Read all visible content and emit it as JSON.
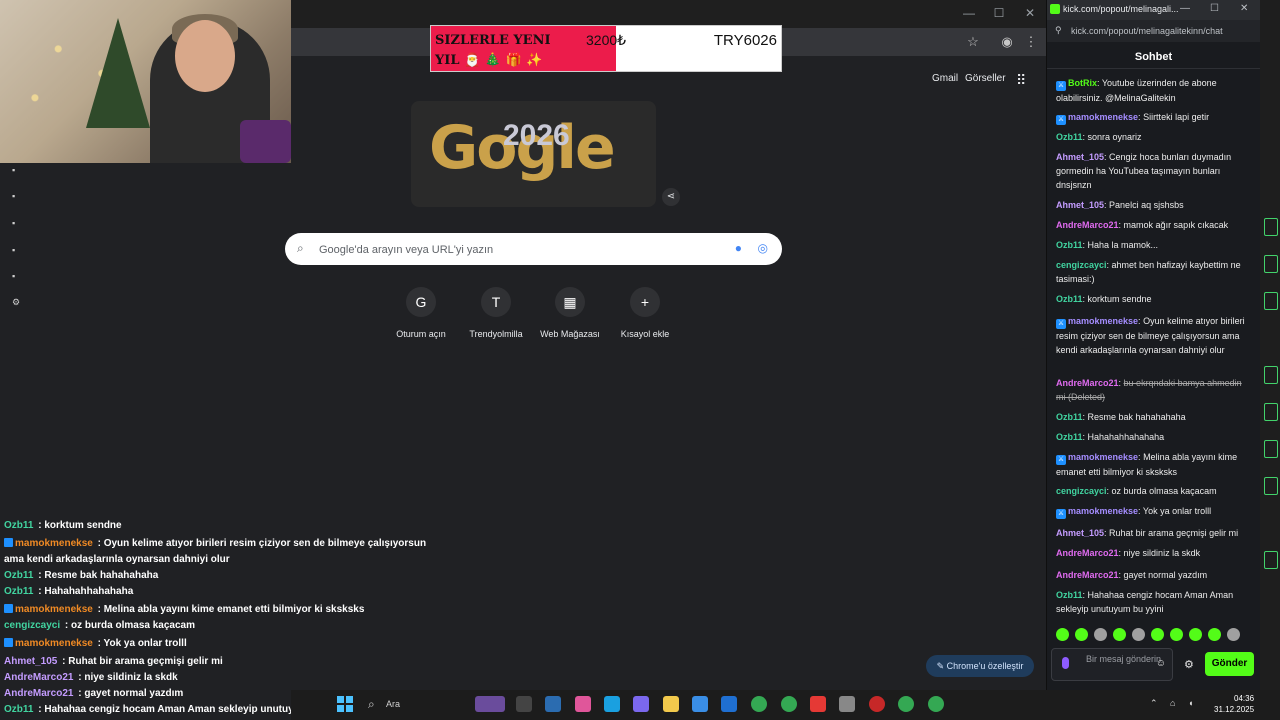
{
  "donation": {
    "message": "SIZLERLE YENI YIL 🎅 🎄 🎁 ✨",
    "amount": "3200₺",
    "goal": "TRY6026"
  },
  "google": {
    "links": {
      "gmail": "Gmail",
      "images": "Görseller"
    },
    "search_placeholder": "Google'da arayın veya URL'yi yazın",
    "shortcuts": [
      {
        "label": "Oturum açın",
        "glyph": "G"
      },
      {
        "label": "Trendyolmilla",
        "glyph": "T"
      },
      {
        "label": "Web Mağazası",
        "glyph": "▦"
      },
      {
        "label": "Kısayol ekle",
        "glyph": "+"
      }
    ],
    "customize_label": "Chrome'u özelleştir",
    "doodle_text": "Gogle",
    "doodle_year": "2026"
  },
  "overlay_chat": [
    {
      "user": "Ozb11",
      "sep": " : ",
      "text": "korktum sendne",
      "color": "#41d4a0"
    },
    {
      "user": "mamokmenekse",
      "sep": " : ",
      "text": "Oyun kelime atıyor birileri resim çiziyor sen de bilmeye çalışıyorsun",
      "color": "#f08a24",
      "badge": true
    },
    {
      "user": "",
      "sep": "",
      "text": "ama kendi arkadaşlarınla oynarsan dahniyi olur",
      "color": "#ffffff"
    },
    {
      "user": "Ozb11",
      "sep": " : ",
      "text": "Resme bak hahahahaha",
      "color": "#41d4a0"
    },
    {
      "user": "Ozb11",
      "sep": " : ",
      "text": "Hahahahhahahaha",
      "color": "#41d4a0"
    },
    {
      "user": "mamokmenekse",
      "sep": " : ",
      "text": "Melina abla yayını kime emanet etti bilmiyor ki sksksks",
      "color": "#f08a24",
      "badge": true
    },
    {
      "user": "cengizcayci",
      "sep": " : ",
      "text": "oz burda olmasa kaçacam",
      "color": "#41d4a0"
    },
    {
      "user": "mamokmenekse",
      "sep": " : ",
      "text": "Yok ya onlar trolll",
      "color": "#f08a24",
      "badge": true
    },
    {
      "user": "Ahmet_105",
      "sep": " : ",
      "text": "Ruhat bir arama geçmişi gelir mi",
      "color": "#c49cff"
    },
    {
      "user": "AndreMarco21",
      "sep": " : ",
      "text": "niye sildiniz la skdk",
      "color": "#c49cff"
    },
    {
      "user": "AndreMarco21",
      "sep": " : ",
      "text": "gayet normal yazdım",
      "color": "#c49cff"
    },
    {
      "user": "Ozb11",
      "sep": " : ",
      "text": "Hahahaa cengiz hocam Aman Aman sekleyip unutuyum bu yyini",
      "color": "#41d4a0"
    }
  ],
  "kick": {
    "window_title": "kick.com/popout/melinagali...",
    "url": "kick.com/popout/melinagalitekinn/chat",
    "header": "Sohbet",
    "messages": [
      {
        "user": "BotRix",
        "text": "Youtube üzerinden de abone olabilirsiniz. @MelinaGalitekin",
        "color": "#53fc18",
        "badge": true
      },
      {
        "user": "mamokmenekse",
        "text": "Siirtteki lapi getir",
        "color": "#a58dff",
        "badge": true
      },
      {
        "user": "Ozb11",
        "text": "sonra oynariz",
        "color": "#41d4a0"
      },
      {
        "user": "Ahmet_105",
        "text": "Cengiz hoca bunları duymadın gormedin ha YouTubea taşımayın bunları dnsjsnzn",
        "color": "#c49cff"
      },
      {
        "user": "Ahmet_105",
        "text": "Panelci aq sjshsbs",
        "color": "#c49cff"
      },
      {
        "user": "AndreMarco21",
        "text": "mamok ağır sapık cıkacak",
        "color": "#e06bf0"
      },
      {
        "user": "Ozb11",
        "text": "Haha la mamok...",
        "color": "#41d4a0"
      },
      {
        "user": "cengizcayci",
        "text": "ahmet ben hafizayi kaybettim ne tasimasi:)",
        "color": "#41d4a0"
      },
      {
        "user": "Ozb11",
        "text": "korktum sendne",
        "color": "#41d4a0"
      },
      {
        "user": "mamokmenekse",
        "text": "Oyun kelime atıyor birileri resim çiziyor sen de bilmeye çalışıyorsun ama kendi arkadaşlarınla oynarsan dahniyi olur",
        "color": "#a58dff",
        "badge": true
      },
      {
        "user": "AndreMarco21",
        "text": "bu ekrqndaki bamya ahmedin mi (Deleted)",
        "color": "#e06bf0",
        "deleted": true
      },
      {
        "user": "Ozb11",
        "text": "Resme bak hahahahaha",
        "color": "#41d4a0"
      },
      {
        "user": "Ozb11",
        "text": "Hahahahhahahaha",
        "color": "#41d4a0"
      },
      {
        "user": "mamokmenekse",
        "text": "Melina abla yayını kime emanet etti bilmiyor ki sksksks",
        "color": "#a58dff",
        "badge": true
      },
      {
        "user": "cengizcayci",
        "text": "oz burda olmasa kaçacam",
        "color": "#41d4a0"
      },
      {
        "user": "mamokmenekse",
        "text": "Yok ya onlar trolll",
        "color": "#a58dff",
        "badge": true
      },
      {
        "user": "Ahmet_105",
        "text": "Ruhat bir arama geçmişi gelir mi",
        "color": "#c49cff"
      },
      {
        "user": "AndreMarco21",
        "text": "niye sildiniz la skdk",
        "color": "#e06bf0"
      },
      {
        "user": "AndreMarco21",
        "text": "gayet normal yazdım",
        "color": "#e06bf0"
      },
      {
        "user": "Ozb11",
        "text": "Hahahaa cengiz hocam Aman Aman sekleyip unutuyum bu yyini",
        "color": "#41d4a0"
      }
    ],
    "input_placeholder": "Bir mesaj gönderin",
    "send_label": "Gönder"
  },
  "taskbar": {
    "search_label": "Ara",
    "time": "04:36",
    "date": "31.12.2025"
  },
  "colors": {
    "kick_green": "#53fc18",
    "chrome_bg": "#202124"
  }
}
